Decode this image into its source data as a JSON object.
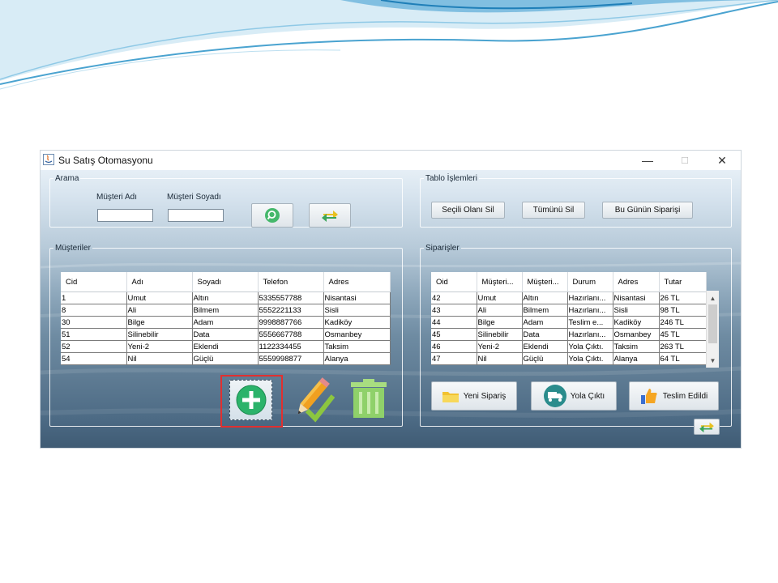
{
  "window": {
    "title": "Su Satış Otomasyonu",
    "controls": {
      "minimize": "—",
      "maximize": "☐",
      "close": "✕"
    }
  },
  "search": {
    "legend": "Arama",
    "first_name_label": "Müşteri Adı",
    "last_name_label": "Müşteri Soyadı",
    "first_name_value": "",
    "last_name_value": "",
    "search_icon": "magnifier-icon",
    "refresh_icon": "refresh-arrows-icon"
  },
  "table_ops": {
    "legend": "Tablo İşlemleri",
    "delete_selected": "Seçili Olanı Sil",
    "delete_all": "Tümünü Sil",
    "todays_orders": "Bu Günün Siparişi"
  },
  "customers": {
    "legend": "Müşteriler",
    "columns": [
      "Cid",
      "Adı",
      "Soyadı",
      "Telefon",
      "Adres"
    ],
    "rows": [
      [
        "1",
        "Umut",
        "Altın",
        "5335557788",
        "Nisantasi"
      ],
      [
        "8",
        "Ali",
        "Bilmem",
        "5552221133",
        "Sisli"
      ],
      [
        "30",
        "Bilge",
        "Adam",
        "9998887766",
        "Kadiköy"
      ],
      [
        "51",
        "Silinebilir",
        "Data",
        "5556667788",
        "Osmanbey"
      ],
      [
        "52",
        "Yeni-2",
        "Eklendi",
        "1122334455",
        "Taksim"
      ],
      [
        "54",
        "Nil",
        "Güçlü",
        "5559998877",
        "Alanya"
      ]
    ],
    "actions": {
      "add_icon": "plus-circle-icon",
      "edit_icon": "pencil-check-icon",
      "delete_icon": "trash-can-icon"
    }
  },
  "orders": {
    "legend": "Siparişler",
    "columns": [
      "Oid",
      "Müşteri...",
      "Müşteri...",
      "Durum",
      "Adres",
      "Tutar"
    ],
    "rows": [
      [
        "42",
        "Umut",
        "Altın",
        "Hazırlanı...",
        "Nisantasi",
        "26 TL"
      ],
      [
        "43",
        "Ali",
        "Bilmem",
        "Hazırlanı...",
        "Sisli",
        "98 TL"
      ],
      [
        "44",
        "Bilge",
        "Adam",
        "Teslim e...",
        "Kadiköy",
        "246 TL"
      ],
      [
        "45",
        "Silinebilir",
        "Data",
        "Hazırlanı...",
        "Osmanbey",
        "45 TL"
      ],
      [
        "46",
        "Yeni-2",
        "Eklendi",
        "Yola Çıktı.",
        "Taksim",
        "263 TL"
      ],
      [
        "47",
        "Nil",
        "Güçlü",
        "Yola Çıktı.",
        "Alanya",
        "64 TL"
      ]
    ],
    "buttons": {
      "new_order": "Yeni Sipariş",
      "on_the_way": "Yola Çıktı",
      "delivered": "Teslim Edildi"
    },
    "refresh_icon": "refresh-arrows-icon"
  },
  "colors": {
    "highlight": "#e03030",
    "add_green": "#2bb36a",
    "trash_green": "#8fd16a",
    "pencil_orange": "#f0a020"
  }
}
